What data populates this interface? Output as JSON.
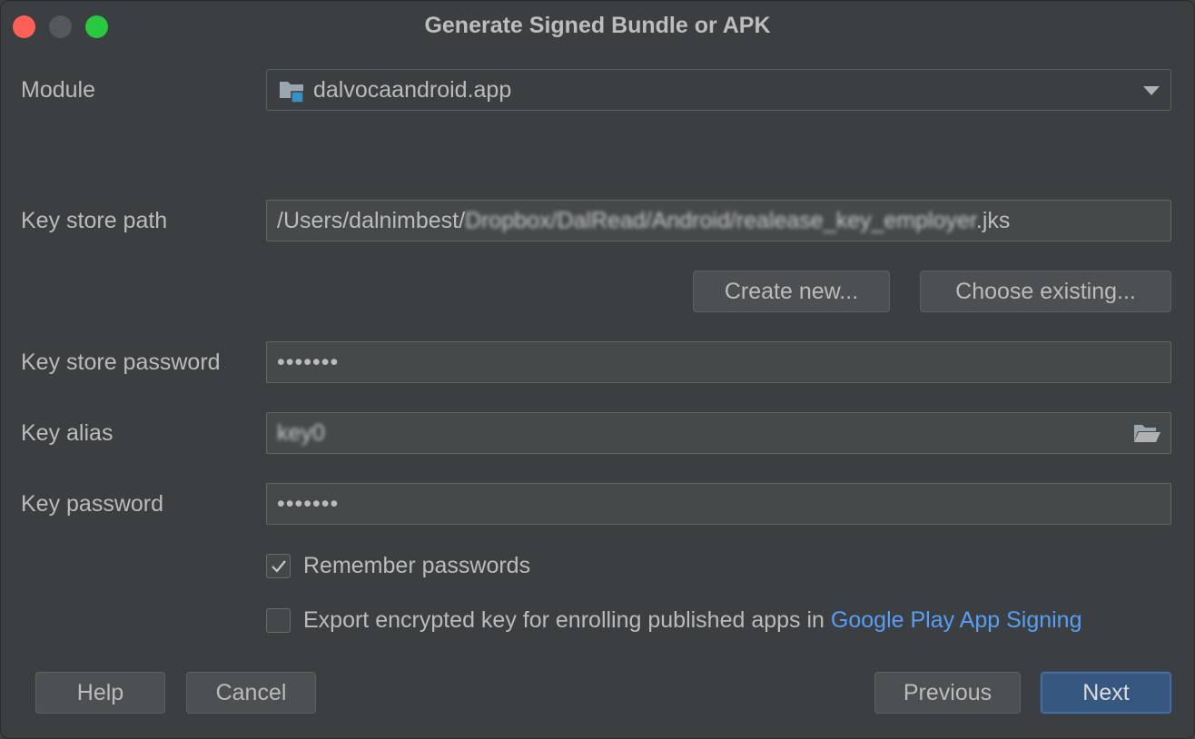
{
  "window": {
    "title": "Generate Signed Bundle or APK"
  },
  "module": {
    "label": "Module",
    "value": "dalvocaandroid.app"
  },
  "keystore_path": {
    "label": "Key store path",
    "prefix": "/Users/dalnimbest/",
    "obscured": "Dropbox/DalRead/Android/realease_key_employer",
    "suffix": ".jks"
  },
  "buttons": {
    "create_new": "Create new...",
    "choose_existing": "Choose existing...",
    "help": "Help",
    "cancel": "Cancel",
    "previous": "Previous",
    "next": "Next"
  },
  "keystore_password": {
    "label": "Key store password",
    "value": "•••••••"
  },
  "key_alias": {
    "label": "Key alias",
    "value": "key0"
  },
  "key_password": {
    "label": "Key password",
    "value": "•••••••"
  },
  "options": {
    "remember_passwords": {
      "label": "Remember passwords",
      "checked": true
    },
    "export_key": {
      "label": "Export encrypted key for enrolling published apps in ",
      "link": "Google Play App Signing",
      "checked": false
    }
  },
  "colors": {
    "background": "#3c3f41",
    "field_bg": "#45494a",
    "primary_button": "#365880",
    "link": "#589df6"
  }
}
